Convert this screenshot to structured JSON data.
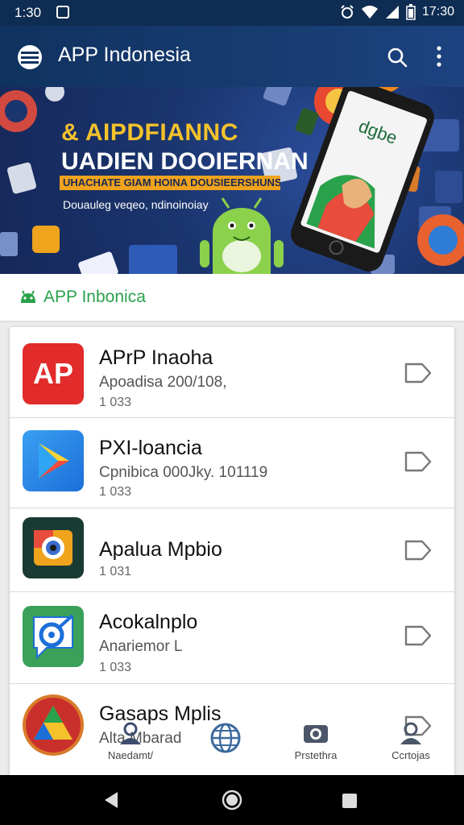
{
  "status_bar": {
    "time": "1:30",
    "clock": "17:30"
  },
  "app_bar": {
    "title": "APP Indonesia"
  },
  "banner": {
    "title": "& AIPDFIANNC",
    "subtitle": "UADIEN DOOIERNAN",
    "ribbon": "UHACHATE GIAM HOINA DOUSIEERSHUNS",
    "caption": "Douauleg veqeo, ndinoinoiay"
  },
  "section": {
    "title": "APP Inbonica"
  },
  "apps": [
    {
      "name": "APrP Inaoha",
      "sub": "Apoadisa 200/108,",
      "size": "1 033"
    },
    {
      "name": "PXI-loancia",
      "sub": "Cpnibica 000Jky. 101119",
      "size": "1 033"
    },
    {
      "name": "Apalua Mpbio",
      "sub": "",
      "size": "1 031"
    },
    {
      "name": "Acokalnplo",
      "sub": "Anariemor L",
      "size": "1 033"
    },
    {
      "name": "Gasaps Mplis",
      "sub": "Alta Mbarad",
      "size": ""
    }
  ],
  "bottom_nav": [
    {
      "label": "Naedamt/",
      "icon": "person-icon"
    },
    {
      "label": "",
      "icon": "globe-icon"
    },
    {
      "label": "Prstethra",
      "icon": "camera-icon"
    },
    {
      "label": "Ccrtojas",
      "icon": "contact-icon"
    }
  ],
  "colors": {
    "app_bar": "#103260",
    "accent_green": "#2aa14b",
    "ribbon": "#f0a31c",
    "banner_title": "#f4c22b"
  }
}
